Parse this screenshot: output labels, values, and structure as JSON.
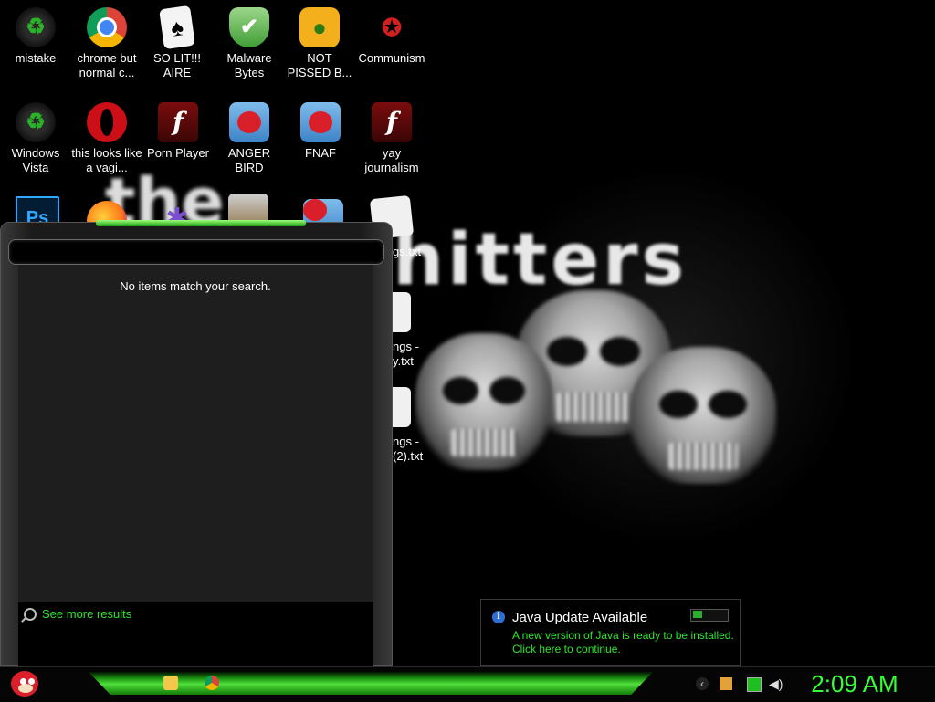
{
  "desktop_icons": [
    {
      "label": "mistake",
      "icon": "recycle-bin-icon"
    },
    {
      "label": "chrome but normal c...",
      "icon": "chrome-icon"
    },
    {
      "label": "SO LIT!!! AIRE",
      "icon": "playing-cards-icon"
    },
    {
      "label": "Malware Bytes",
      "icon": "shield-check-icon"
    },
    {
      "label": "NOT PISSED B...",
      "icon": "green-pig-icon"
    },
    {
      "label": "Communism",
      "icon": "emblem-icon"
    },
    {
      "label": "Windows Vista",
      "icon": "recycle-bin-icon"
    },
    {
      "label": "this looks like a vagi...",
      "icon": "opera-icon"
    },
    {
      "label": "Porn Player",
      "icon": "flash-icon"
    },
    {
      "label": "ANGER BIRD",
      "icon": "angry-bird-icon"
    },
    {
      "label": "FNAF",
      "icon": "angry-bird-icon"
    },
    {
      "label": "yay journalism",
      "icon": "flash-icon"
    }
  ],
  "partial_icon_labels": [
    "gs.txt",
    "ngs -",
    "y.txt",
    "ngs -",
    "(2).txt"
  ],
  "wallpaper": {
    "word_top": "the",
    "word_main": "shitters"
  },
  "start_menu": {
    "no_results_text": "No items match your search.",
    "see_more_text": "See more results"
  },
  "notification": {
    "title": "Java Update Available",
    "line1": "A new version of Java is ready to be installed.",
    "line2": "Click here to continue."
  },
  "taskbar": {
    "clock": "2:09 AM",
    "pinned": [
      "file-explorer-icon",
      "chrome-icon"
    ]
  },
  "colors": {
    "accent_green": "#36ff36",
    "link_green": "#2ee52e",
    "bird_red": "#d9202a"
  }
}
